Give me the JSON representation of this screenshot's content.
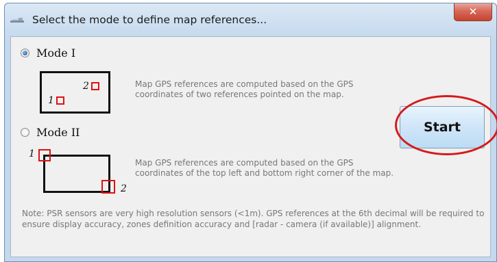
{
  "window": {
    "title": "Select the mode to define map references...",
    "close_glyph": "✕"
  },
  "mode1": {
    "label": "Mode I",
    "selected": true,
    "description": "Map GPS references are computed based on the GPS coordinates of two references pointed on the map.",
    "ref1": "1",
    "ref2": "2"
  },
  "mode2": {
    "label": "Mode II",
    "selected": false,
    "description": "Map GPS references are computed based on the GPS coordinates of the top left and bottom right corner of the map.",
    "ref1": "1",
    "ref2": "2"
  },
  "start_button": {
    "label": "Start"
  },
  "note": "Note: PSR sensors are very high resolution sensors (<1m). GPS references at the 6th decimal will be required to ensure display accuracy, zones definition accuracy and [radar - camera (if available)] alignment.",
  "colors": {
    "marker": "#e01010",
    "highlight": "#d61a1a",
    "description_text": "#777777"
  },
  "icons": {
    "app": "map-app-icon",
    "close": "close-icon",
    "radio_checked": "radio-checked-icon",
    "radio_unchecked": "radio-unchecked-icon"
  }
}
